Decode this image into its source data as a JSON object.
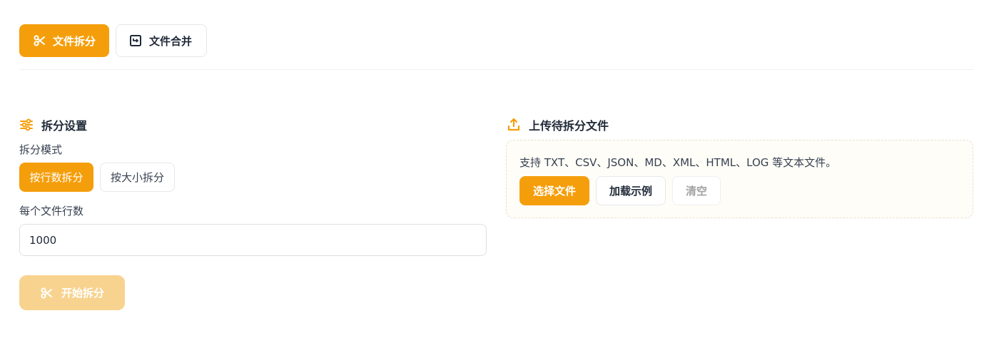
{
  "tabs": [
    {
      "label": "文件拆分",
      "icon": "scissors-icon",
      "active": true
    },
    {
      "label": "文件合并",
      "icon": "merge-icon",
      "active": false
    }
  ],
  "split_settings": {
    "title": "拆分设置",
    "icon": "sliders-icon",
    "mode_label": "拆分模式",
    "modes": [
      {
        "label": "按行数拆分",
        "active": true
      },
      {
        "label": "按大小拆分",
        "active": false
      }
    ],
    "lines_label": "每个文件行数",
    "lines_value": "1000",
    "start_label": "开始拆分"
  },
  "upload": {
    "title": "上传待拆分文件",
    "icon": "upload-icon",
    "note": "支持 TXT、CSV、JSON、MD、XML、HTML、LOG 等文本文件。",
    "choose_label": "选择文件",
    "sample_label": "加载示例",
    "clear_label": "清空"
  },
  "colors": {
    "accent": "#f59e0b",
    "accent_disabled": "#f8d38f",
    "text": "#1f2937"
  }
}
